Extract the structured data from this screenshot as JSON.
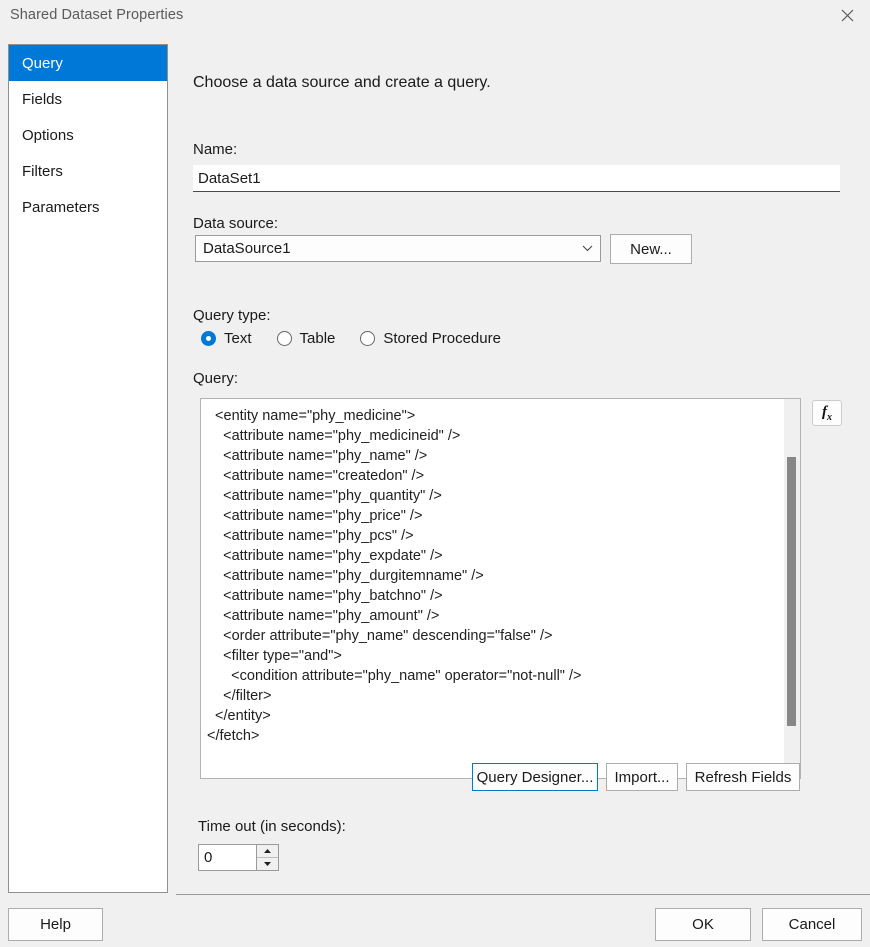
{
  "window": {
    "title": "Shared Dataset Properties",
    "close_icon": "close-icon"
  },
  "sidebar": {
    "items": [
      {
        "label": "Query",
        "selected": true
      },
      {
        "label": "Fields",
        "selected": false
      },
      {
        "label": "Options",
        "selected": false
      },
      {
        "label": "Filters",
        "selected": false
      },
      {
        "label": "Parameters",
        "selected": false
      }
    ]
  },
  "main": {
    "headline": "Choose a data source and create a query.",
    "name": {
      "label": "Name:",
      "value": "DataSet1",
      "placeholder": ""
    },
    "data_source": {
      "label": "Data source:",
      "value": "DataSource1",
      "arrow_icon": "chevron-down-icon",
      "new_button": "New..."
    },
    "query_type": {
      "label": "Query type:",
      "options": [
        {
          "label": "Text",
          "checked": true
        },
        {
          "label": "Table",
          "checked": false
        },
        {
          "label": "Stored Procedure",
          "checked": false
        }
      ]
    },
    "query": {
      "label": "Query:",
      "text": "  <entity name=\"phy_medicine\">\n    <attribute name=\"phy_medicineid\" />\n    <attribute name=\"phy_name\" />\n    <attribute name=\"createdon\" />\n    <attribute name=\"phy_quantity\" />\n    <attribute name=\"phy_price\" />\n    <attribute name=\"phy_pcs\" />\n    <attribute name=\"phy_expdate\" />\n    <attribute name=\"phy_durgitemname\" />\n    <attribute name=\"phy_batchno\" />\n    <attribute name=\"phy_amount\" />\n    <order attribute=\"phy_name\" descending=\"false\" />\n    <filter type=\"and\">\n      <condition attribute=\"phy_name\" operator=\"not-null\" />\n    </filter>\n  </entity>\n</fetch>",
      "expression_button": "fx"
    },
    "actions": {
      "query_designer": "Query Designer...",
      "import": "Import...",
      "refresh_fields": "Refresh Fields"
    },
    "timeout": {
      "label": "Time out (in seconds):",
      "value": "0"
    }
  },
  "footer": {
    "help": "Help",
    "ok": "OK",
    "cancel": "Cancel"
  },
  "colors": {
    "accent": "#0078d7",
    "window_bg": "#f0f0f0",
    "panel_bg": "#ffffff"
  }
}
